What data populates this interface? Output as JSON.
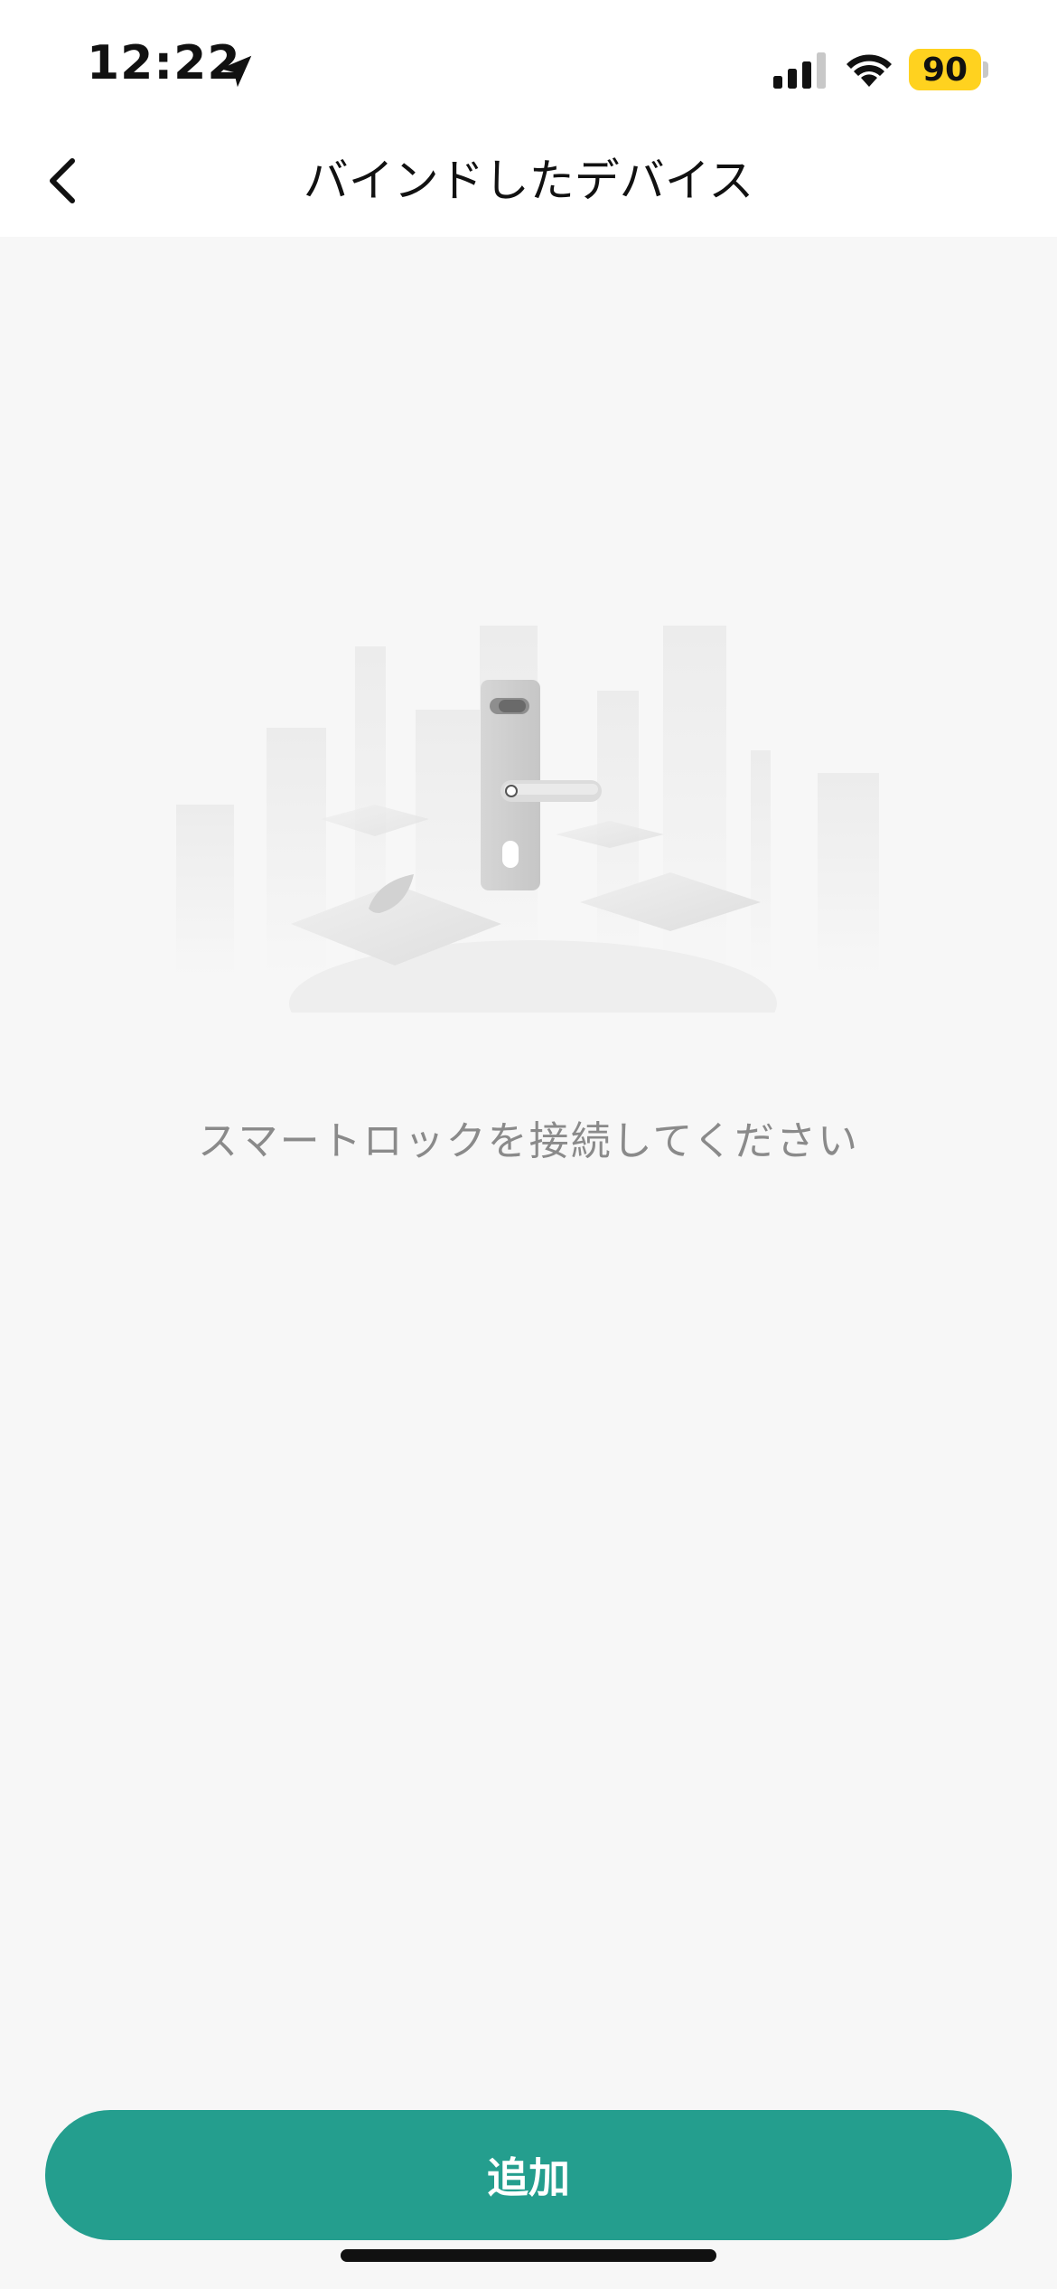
{
  "status_bar": {
    "time": "12:22",
    "battery_level": "90",
    "icons": [
      "location-arrow-icon",
      "cellular-signal-icon",
      "wifi-icon",
      "battery-icon"
    ],
    "battery_color": "#ffd21f"
  },
  "nav": {
    "title": "バインドしたデバイス",
    "back_icon": "chevron-left-icon"
  },
  "empty_state": {
    "illustration": "smart-lock-cityscape-illustration",
    "message": "スマートロックを接続してください"
  },
  "footer": {
    "add_button_label": "追加",
    "accent_color": "#249e8e"
  }
}
